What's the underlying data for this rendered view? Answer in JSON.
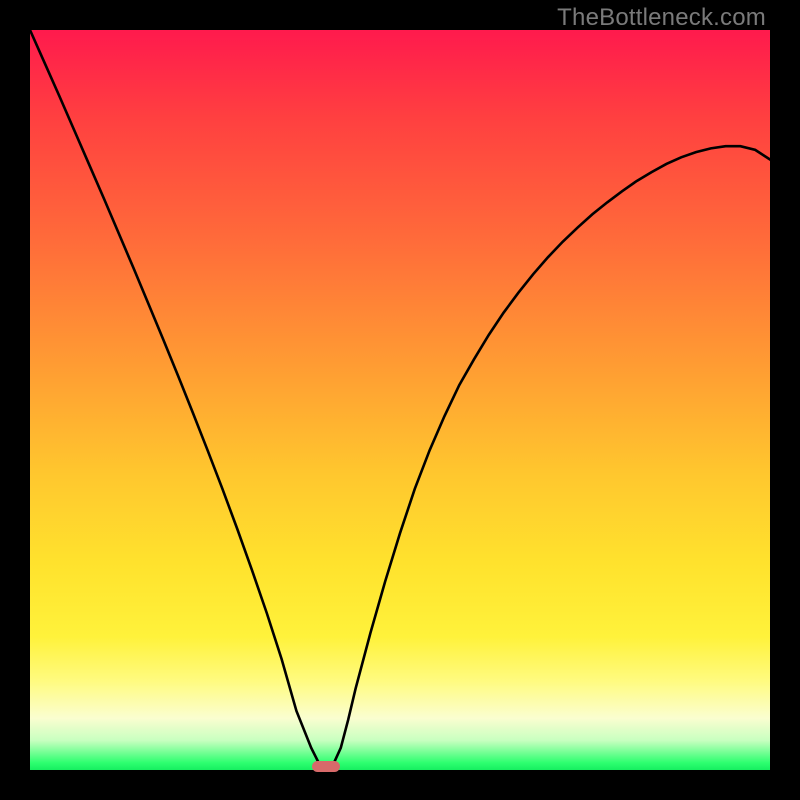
{
  "watermark": "TheBottleneck.com",
  "chart_data": {
    "type": "line",
    "title": "",
    "xlabel": "",
    "ylabel": "",
    "xlim": [
      0,
      1
    ],
    "ylim": [
      0,
      1
    ],
    "x": [
      0.0,
      0.02,
      0.04,
      0.06,
      0.08,
      0.1,
      0.12,
      0.14,
      0.16,
      0.18,
      0.2,
      0.22,
      0.24,
      0.26,
      0.28,
      0.3,
      0.32,
      0.34,
      0.36,
      0.38,
      0.39,
      0.4,
      0.41,
      0.42,
      0.43,
      0.44,
      0.46,
      0.48,
      0.5,
      0.52,
      0.54,
      0.56,
      0.58,
      0.6,
      0.62,
      0.64,
      0.66,
      0.68,
      0.7,
      0.72,
      0.74,
      0.76,
      0.78,
      0.8,
      0.82,
      0.84,
      0.86,
      0.88,
      0.9,
      0.92,
      0.94,
      0.96,
      0.98,
      1.0
    ],
    "values": [
      1.0,
      0.955,
      0.91,
      0.864,
      0.818,
      0.772,
      0.725,
      0.678,
      0.63,
      0.582,
      0.533,
      0.483,
      0.432,
      0.38,
      0.326,
      0.27,
      0.212,
      0.15,
      0.08,
      0.03,
      0.01,
      0.0,
      0.008,
      0.03,
      0.068,
      0.11,
      0.185,
      0.255,
      0.32,
      0.38,
      0.432,
      0.478,
      0.52,
      0.555,
      0.588,
      0.618,
      0.645,
      0.67,
      0.693,
      0.714,
      0.733,
      0.751,
      0.767,
      0.782,
      0.796,
      0.808,
      0.819,
      0.828,
      0.835,
      0.84,
      0.843,
      0.843,
      0.838,
      0.825
    ],
    "marker": {
      "x": 0.4,
      "y": 0.0
    },
    "gradient_stops": [
      {
        "pos": 0.0,
        "color": "#ff1a4d"
      },
      {
        "pos": 0.28,
        "color": "#ff6a3a"
      },
      {
        "pos": 0.6,
        "color": "#ffc72e"
      },
      {
        "pos": 0.82,
        "color": "#fff23b"
      },
      {
        "pos": 0.93,
        "color": "#fafed0"
      },
      {
        "pos": 1.0,
        "color": "#16ef60"
      }
    ]
  }
}
